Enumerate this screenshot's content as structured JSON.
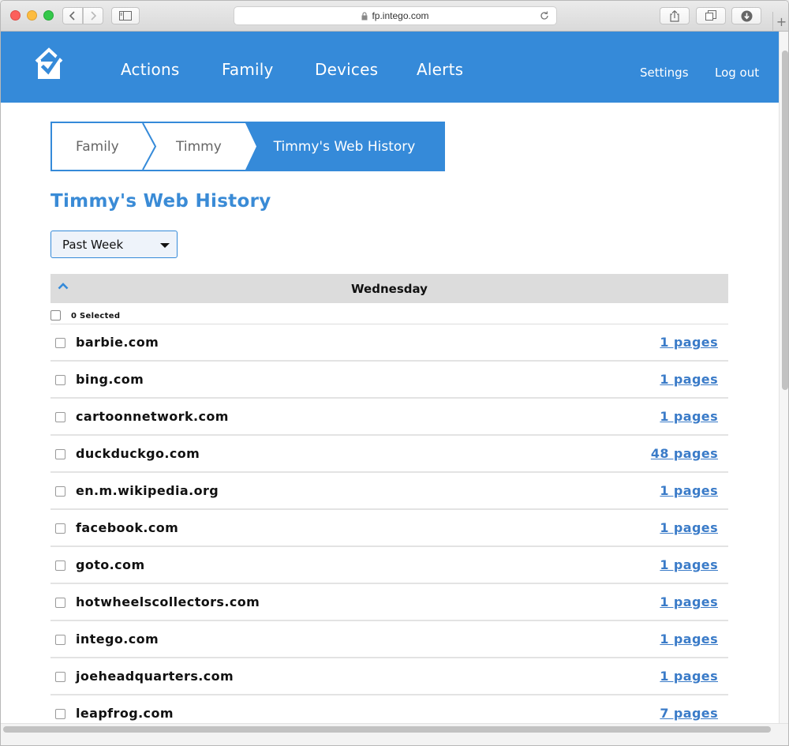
{
  "browser": {
    "url": "fp.intego.com"
  },
  "nav": {
    "items": [
      "Actions",
      "Family",
      "Devices",
      "Alerts"
    ],
    "settings": "Settings",
    "logout": "Log out"
  },
  "breadcrumb": {
    "items": [
      "Family",
      "Timmy"
    ],
    "current": "Timmy's Web History"
  },
  "page": {
    "title": "Timmy's Web History",
    "period_select": "Past Week"
  },
  "history": {
    "day": "Wednesday",
    "selected_label": "0 Selected",
    "rows": [
      {
        "domain": "barbie.com",
        "pages": "1 pages"
      },
      {
        "domain": "bing.com",
        "pages": "1 pages"
      },
      {
        "domain": "cartoonnetwork.com",
        "pages": "1 pages"
      },
      {
        "domain": "duckduckgo.com",
        "pages": "48 pages"
      },
      {
        "domain": "en.m.wikipedia.org",
        "pages": "1 pages"
      },
      {
        "domain": "facebook.com",
        "pages": "1 pages"
      },
      {
        "domain": "goto.com",
        "pages": "1 pages"
      },
      {
        "domain": "hotwheelscollectors.com",
        "pages": "1 pages"
      },
      {
        "domain": "intego.com",
        "pages": "1 pages"
      },
      {
        "domain": "joeheadquarters.com",
        "pages": "1 pages"
      },
      {
        "domain": "leapfrog.com",
        "pages": "7 pages"
      }
    ]
  },
  "colors": {
    "brand_blue": "#358ad9",
    "title_blue": "#3a8bd6",
    "link_blue": "#3a7bc8"
  }
}
